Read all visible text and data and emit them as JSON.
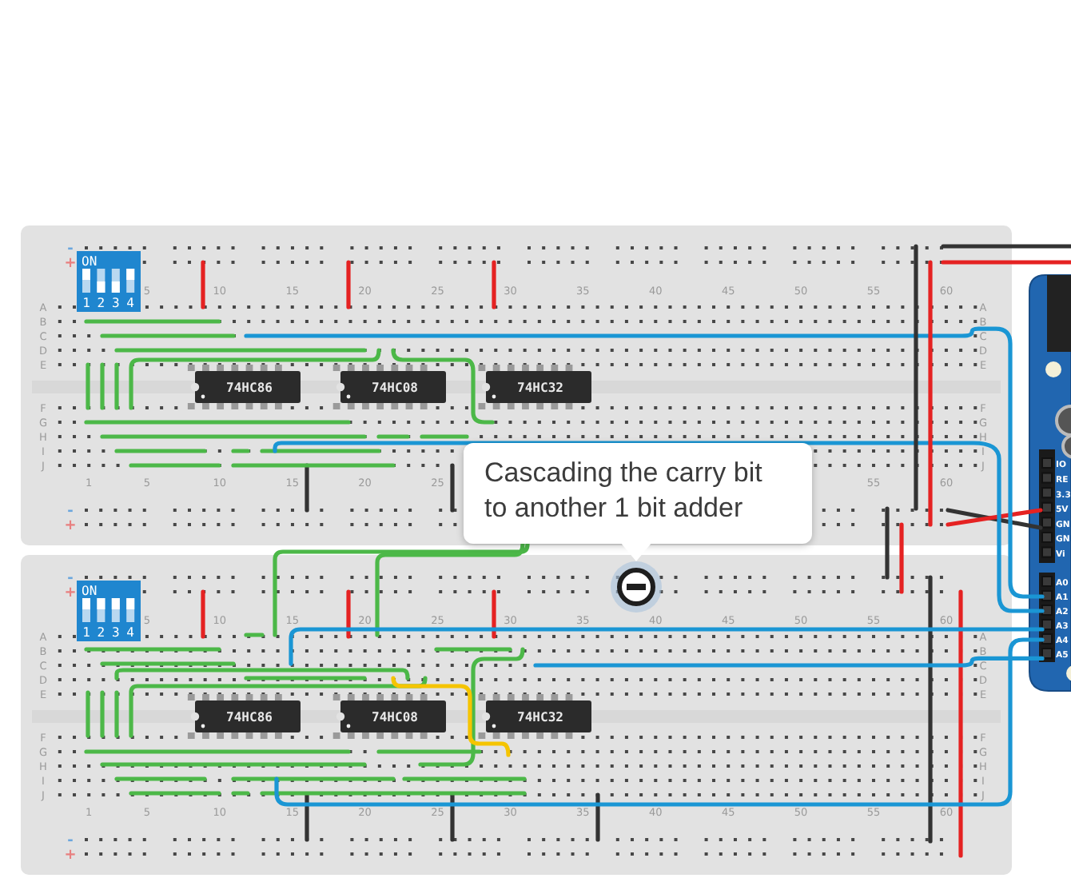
{
  "boards": [
    {
      "dip": {
        "label": "ON",
        "switches": [
          {
            "label": "1",
            "on": true
          },
          {
            "label": "2",
            "on": false
          },
          {
            "label": "3",
            "on": false
          },
          {
            "label": "4",
            "on": true
          }
        ]
      },
      "rail_labels": [
        {
          "kind": "negative",
          "text": "-"
        },
        {
          "kind": "positive",
          "text": "+"
        },
        {
          "kind": "negative",
          "text": "-"
        },
        {
          "kind": "positive",
          "text": "+"
        }
      ],
      "rows_left": [
        "A",
        "B",
        "C",
        "D",
        "E",
        "F",
        "G",
        "H",
        "I",
        "J"
      ],
      "rows_right": [
        "A",
        "B",
        "C",
        "D",
        "E",
        "F",
        "G",
        "H",
        "I",
        "J"
      ],
      "top_numbers": [
        "5",
        "10",
        "15",
        "20",
        "25",
        "30",
        "35",
        "40",
        "45",
        "50",
        "55",
        "60"
      ],
      "bottom_numbers": [
        "1",
        "5",
        "10",
        "15",
        "20",
        "25"
      ],
      "bottom_numbers_end": [
        "55",
        "60"
      ],
      "chips": [
        {
          "label": "74HC86"
        },
        {
          "label": "74HC08"
        },
        {
          "label": "74HC32"
        }
      ]
    },
    {
      "dip": {
        "label": "ON",
        "switches": [
          {
            "label": "1",
            "on": true
          },
          {
            "label": "2",
            "on": true
          },
          {
            "label": "3",
            "on": true
          },
          {
            "label": "4",
            "on": true
          }
        ]
      },
      "rail_labels": [
        {
          "kind": "negative",
          "text": "-"
        },
        {
          "kind": "positive",
          "text": "+"
        },
        {
          "kind": "negative",
          "text": "-"
        },
        {
          "kind": "positive",
          "text": "+"
        }
      ],
      "rows_left": [
        "A",
        "B",
        "C",
        "D",
        "E",
        "F",
        "G",
        "H",
        "I",
        "J"
      ],
      "rows_right": [
        "A",
        "B",
        "C",
        "D",
        "E",
        "F",
        "G",
        "H",
        "I",
        "J"
      ],
      "top_numbers": [
        "5",
        "10",
        "15",
        "20",
        "25",
        "30",
        "35",
        "40",
        "45",
        "50",
        "55",
        "60"
      ],
      "bottom_numbers": [
        "1",
        "5",
        "10",
        "15",
        "20",
        "25",
        "30",
        "35",
        "40",
        "45",
        "50",
        "55",
        "60"
      ],
      "chips": [
        {
          "label": "74HC86"
        },
        {
          "label": "74HC08"
        },
        {
          "label": "74HC32"
        }
      ]
    }
  ],
  "arduino": {
    "pins": [
      "IO",
      "RE",
      "3.3",
      "5V",
      "GN",
      "GN",
      "Vi",
      "A0",
      "A1",
      "A2",
      "A3",
      "A4",
      "A5"
    ]
  },
  "tooltip": {
    "lines": [
      "Cascading the carry bit",
      "to another 1 bit adder"
    ]
  }
}
